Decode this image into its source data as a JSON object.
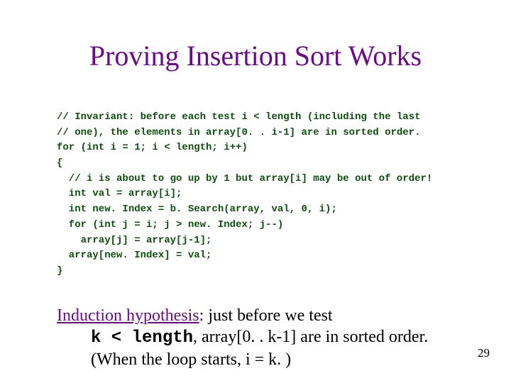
{
  "title": "Proving Insertion Sort Works",
  "code": {
    "l1": "// Invariant: before each test i < length (including the last",
    "l2": "// one), the elements in array[0. . i-1] are in sorted order.",
    "l3": "for (int i = 1; i < length; i++)",
    "l4": "{",
    "l5": "  // i is about to go up by 1 but array[i] may be out of order!",
    "l6": "  int val = array[i];",
    "l7": "  int new. Index = b. Search(array, val, 0, i);",
    "l8": "  for (int j = i; j > new. Index; j--)",
    "l9": "    array[j] = array[j-1];",
    "l10": "  array[new. Index] = val;",
    "l11": "}"
  },
  "hypo": {
    "lead": "Induction hypothesis",
    "after_lead": ": just before we test",
    "line2_mono": "k < length",
    "line2_rest": ", array[0. . k-1] are in sorted order.",
    "line3": "(When the loop starts, i = k. )"
  },
  "slide_number": "29"
}
